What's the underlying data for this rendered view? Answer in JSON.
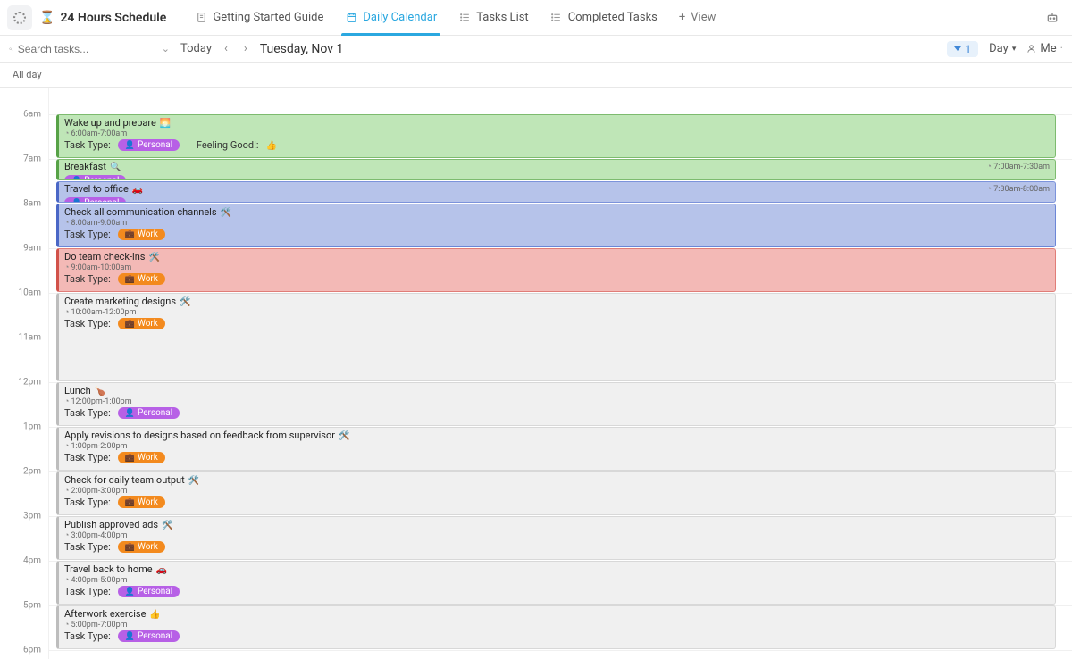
{
  "header": {
    "title": "24 Hours Schedule",
    "tabs": [
      {
        "label": "Getting Started Guide"
      },
      {
        "label": "Daily Calendar"
      },
      {
        "label": "Tasks List"
      },
      {
        "label": "Completed Tasks"
      }
    ],
    "addView": "View"
  },
  "toolbar": {
    "searchPlaceholder": "Search tasks...",
    "today": "Today",
    "currentDate": "Tuesday, Nov 1",
    "filterCount": "1",
    "viewMode": "Day",
    "me": "Me"
  },
  "allDay": "All day",
  "hours": [
    "6am",
    "7am",
    "8am",
    "9am",
    "10am",
    "11am",
    "12pm",
    "1pm",
    "2pm",
    "3pm",
    "4pm",
    "5pm",
    "6pm"
  ],
  "hourPx": 50,
  "startHour": 6,
  "labels": {
    "taskType": "Task Type:",
    "feelingGood": "Feeling Good!:",
    "personal": "Personal",
    "work": "Work"
  },
  "events": [
    {
      "title": "Wake up and prepare",
      "emoji": "sun",
      "start": 6.0,
      "end": 7.0,
      "timeText": "6:00am-7:00am",
      "type": "personal",
      "color": "green",
      "feelingGood": true
    },
    {
      "title": "Breakfast",
      "emoji": "mag",
      "start": 7.0,
      "end": 7.5,
      "timeText": "7:00am-7:30am",
      "timeRight": true,
      "type": "personal",
      "color": "green2",
      "small": true
    },
    {
      "title": "Travel to office",
      "emoji": "car",
      "start": 7.5,
      "end": 8.0,
      "timeText": "7:30am-8:00am",
      "timeRight": true,
      "type": "personal",
      "color": "blue2",
      "small": true
    },
    {
      "title": "Check all communication channels",
      "emoji": "ham",
      "start": 8.0,
      "end": 9.0,
      "timeText": "8:00am-9:00am",
      "type": "work",
      "color": "blue"
    },
    {
      "title": "Do team check-ins",
      "emoji": "ham",
      "start": 9.0,
      "end": 10.0,
      "timeText": "9:00am-10:00am",
      "type": "work",
      "color": "red"
    },
    {
      "title": "Create marketing designs",
      "emoji": "ham",
      "start": 10.0,
      "end": 12.0,
      "timeText": "10:00am-12:00pm",
      "type": "work",
      "color": "gray"
    },
    {
      "title": "Lunch",
      "emoji": "chicken",
      "start": 12.0,
      "end": 13.0,
      "timeText": "12:00pm-1:00pm",
      "type": "personal",
      "color": "gray"
    },
    {
      "title": "Apply revisions to designs based on feedback from supervisor",
      "emoji": "ham",
      "start": 13.0,
      "end": 14.0,
      "timeText": "1:00pm-2:00pm",
      "type": "work",
      "color": "gray"
    },
    {
      "title": "Check for daily team output",
      "emoji": "ham",
      "start": 14.0,
      "end": 15.0,
      "timeText": "2:00pm-3:00pm",
      "type": "work",
      "color": "gray"
    },
    {
      "title": "Publish approved ads",
      "emoji": "ham",
      "start": 15.0,
      "end": 16.0,
      "timeText": "3:00pm-4:00pm",
      "type": "work",
      "color": "gray"
    },
    {
      "title": "Travel back to home",
      "emoji": "car",
      "start": 16.0,
      "end": 17.0,
      "timeText": "4:00pm-5:00pm",
      "type": "personal",
      "color": "gray"
    },
    {
      "title": "Afterwork exercise",
      "emoji": "thumb",
      "start": 17.0,
      "end": 18.0,
      "timeText": "5:00pm-7:00pm",
      "type": "personal",
      "color": "gray"
    }
  ]
}
